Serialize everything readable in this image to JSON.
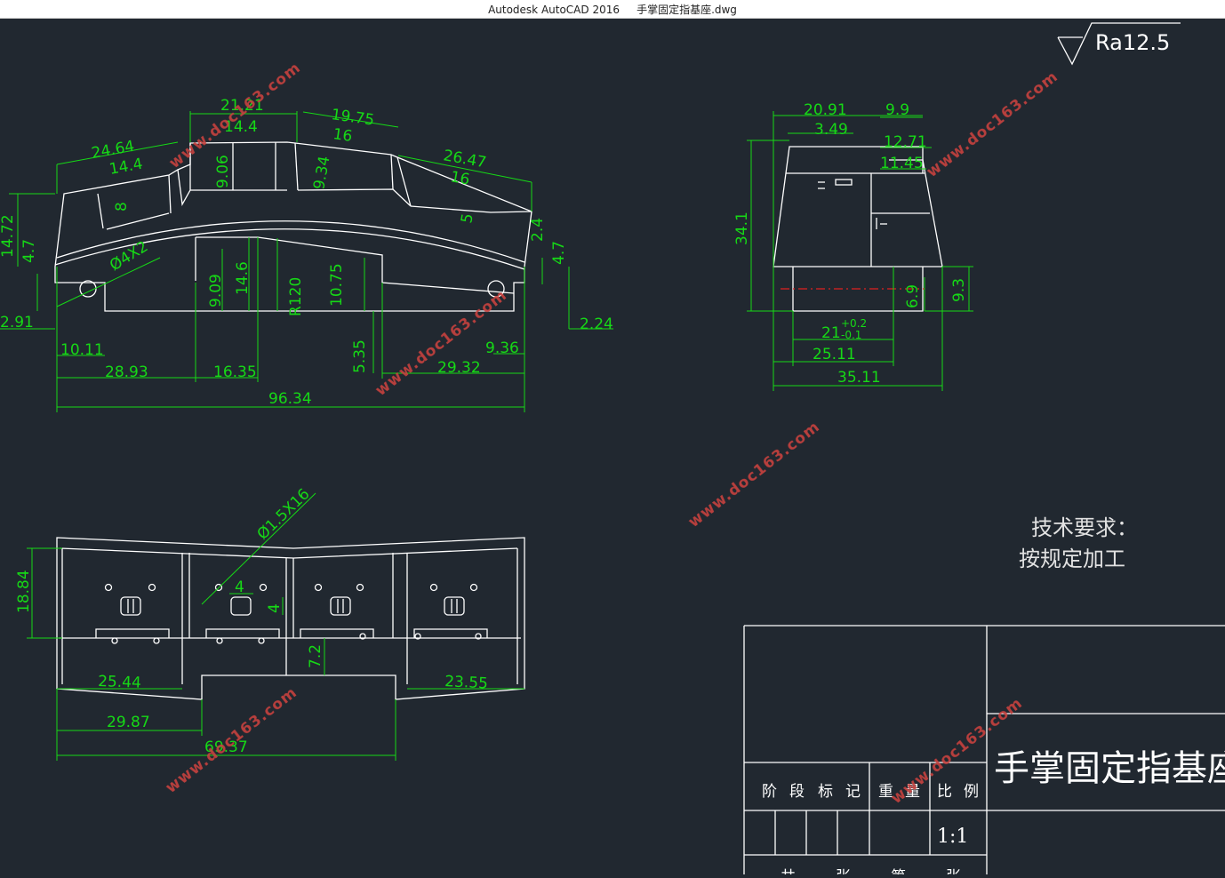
{
  "window": {
    "app": "Autodesk AutoCAD 2016",
    "file": "手掌固定指基座.dwg"
  },
  "watermark": "www.doc163.com",
  "roughness": "Ra12.5",
  "front_view": {
    "labels": [
      "24.64",
      "14.4",
      "8",
      "21.21",
      "14.4",
      "9.06",
      "19.75",
      "16",
      "9.34",
      "26.47",
      "16",
      "5",
      "14.72",
      "4.7",
      "2.4",
      "4.7",
      "Ø4X2",
      "9.09",
      "14.6",
      "R120",
      "10.75",
      "2.91",
      "10.11",
      "28.93",
      "16.35",
      "5.35",
      "29.32",
      "9.36",
      "2.24",
      "96.34"
    ]
  },
  "side_view": {
    "labels": [
      "20.91",
      "9.9",
      "3.49",
      "12.71",
      "11.45",
      "34.1",
      "6.9",
      "9.3",
      "21",
      "+0.2",
      "-0.1",
      "25.11",
      "35.11"
    ]
  },
  "top_view": {
    "labels": [
      "Ø1.5X16",
      "18.84",
      "4",
      "4",
      "7.2",
      "25.44",
      "23.55",
      "29.87",
      "69.37"
    ]
  },
  "notes": {
    "title": "技术要求：",
    "line1": "按规定加工"
  },
  "title_block": {
    "part_name": "手掌固定指基座",
    "headers": [
      "阶",
      "段",
      "标",
      "记",
      "重",
      "量",
      "比",
      "例"
    ],
    "scale": "1:1",
    "bottom_row": [
      "共",
      "张",
      "第",
      "张"
    ]
  }
}
